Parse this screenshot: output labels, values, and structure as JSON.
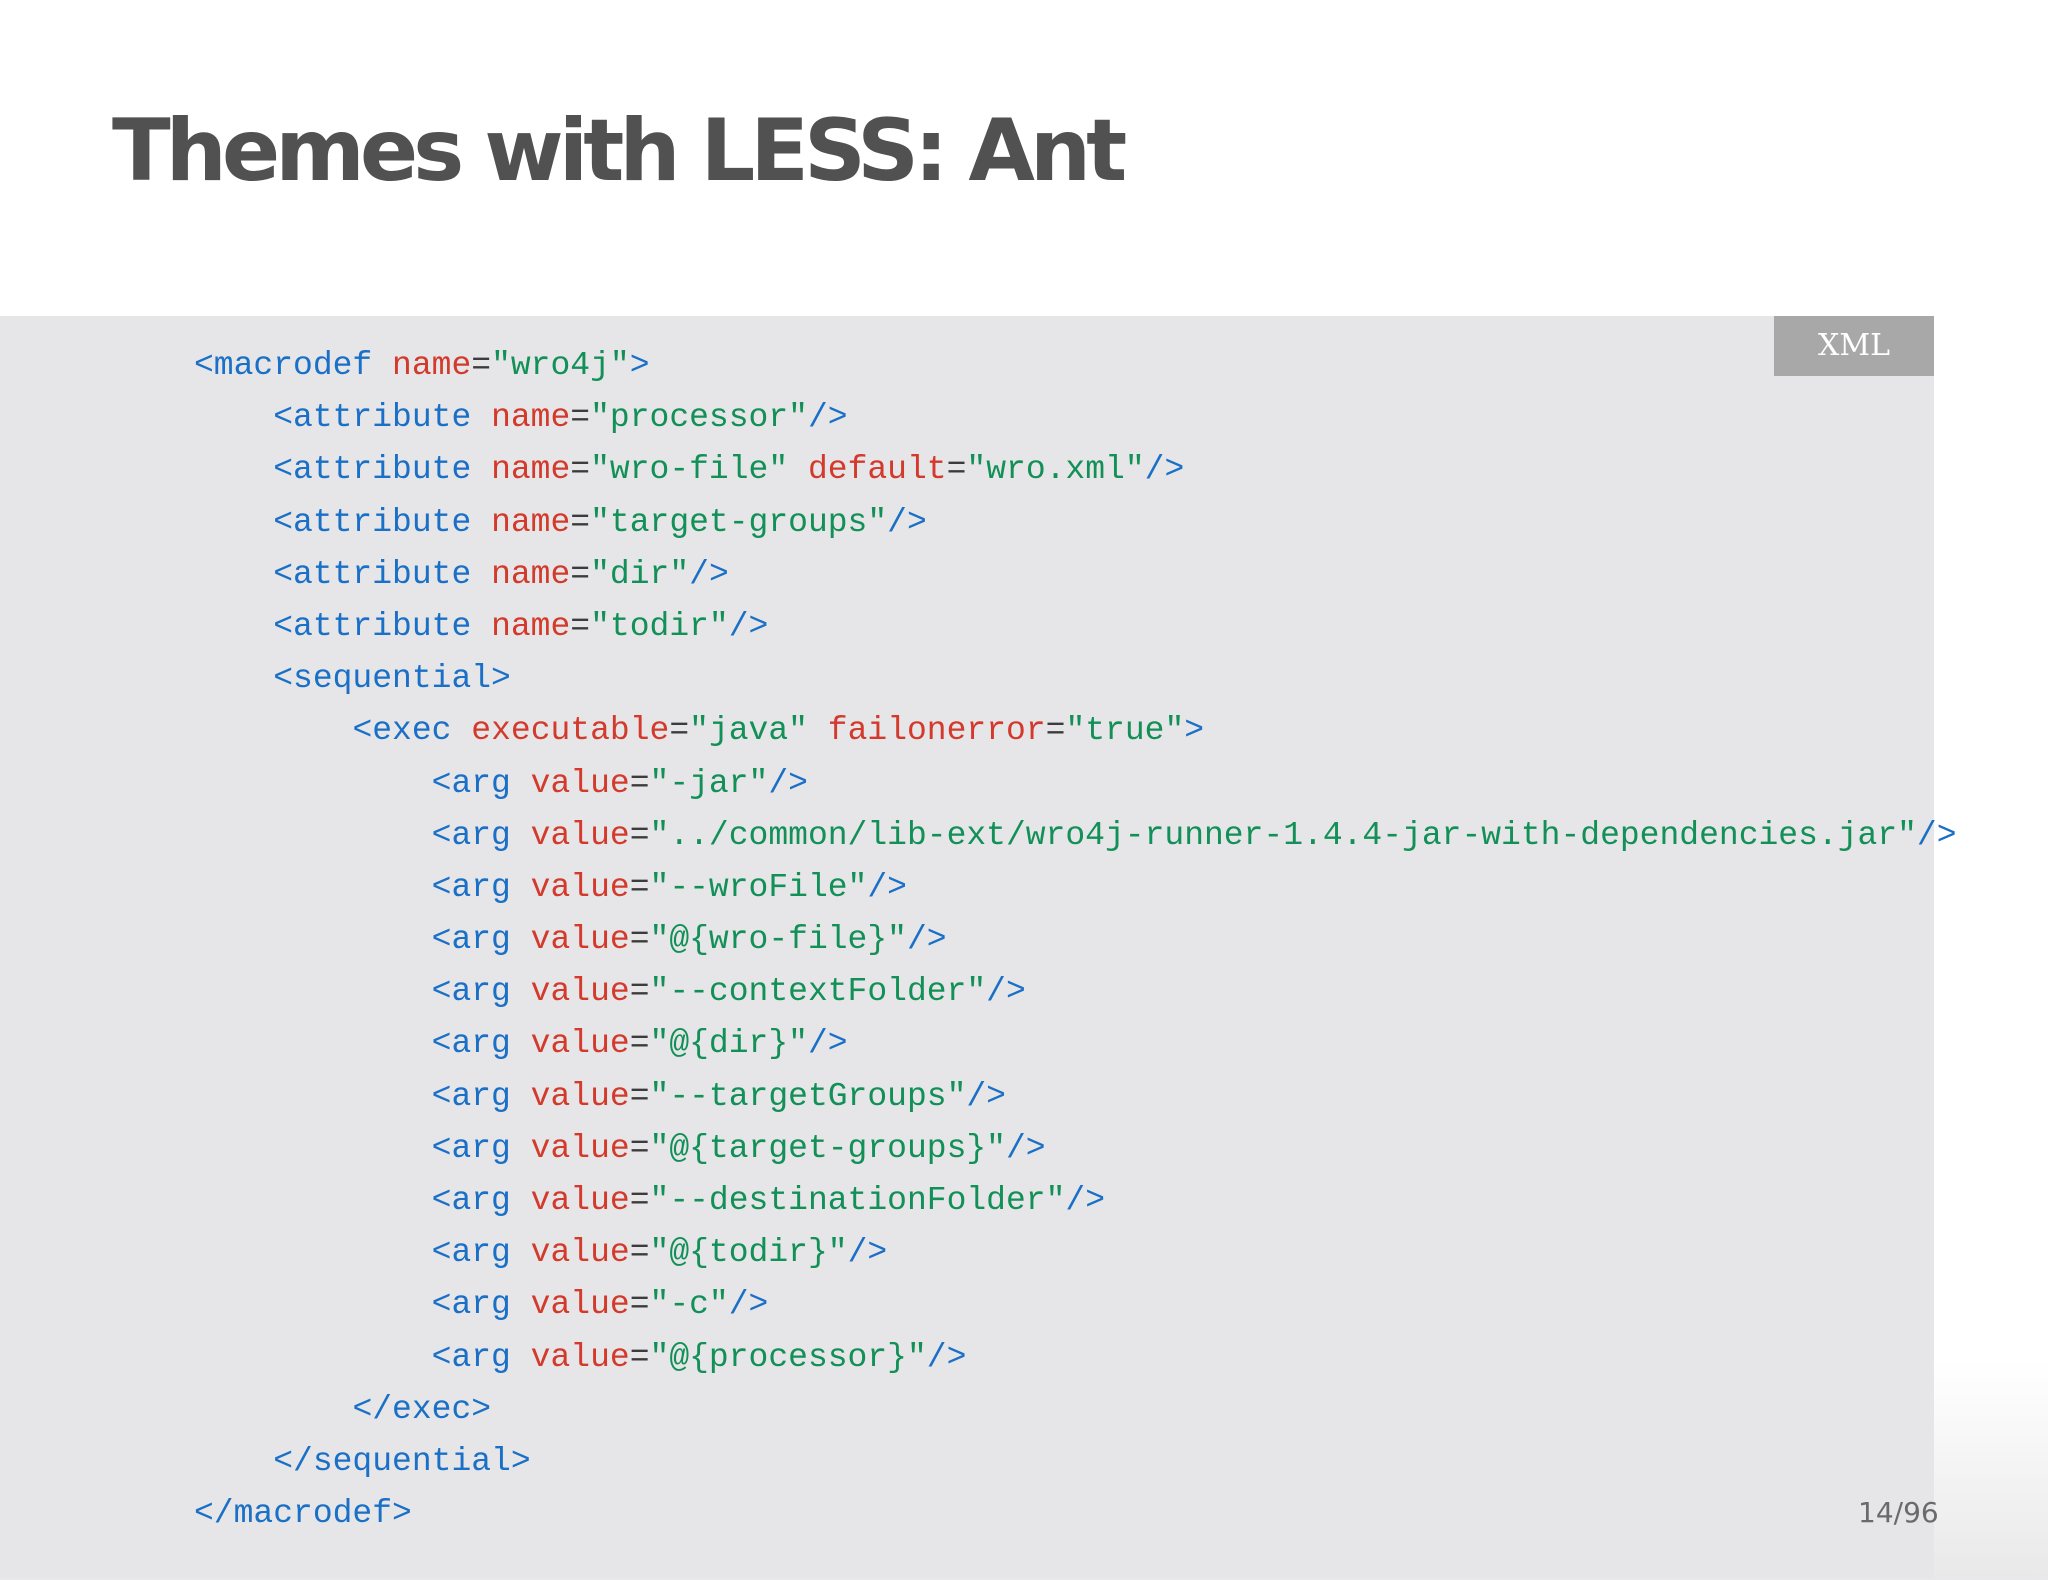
{
  "slide": {
    "title": "Themes with LESS: Ant",
    "code_language": "XML",
    "page_number": "14/96"
  },
  "code": {
    "lines": [
      {
        "indent": 0,
        "tokens": [
          {
            "t": "tag",
            "v": "<macrodef"
          },
          {
            "t": "plain",
            "v": " "
          },
          {
            "t": "attr",
            "v": "name"
          },
          {
            "t": "eq",
            "v": "="
          },
          {
            "t": "val",
            "v": "\"wro4j\""
          },
          {
            "t": "tag",
            "v": ">"
          }
        ]
      },
      {
        "indent": 1,
        "tokens": [
          {
            "t": "tag",
            "v": "<attribute"
          },
          {
            "t": "plain",
            "v": " "
          },
          {
            "t": "attr",
            "v": "name"
          },
          {
            "t": "eq",
            "v": "="
          },
          {
            "t": "val",
            "v": "\"processor\""
          },
          {
            "t": "tag",
            "v": "/>"
          }
        ]
      },
      {
        "indent": 1,
        "tokens": [
          {
            "t": "tag",
            "v": "<attribute"
          },
          {
            "t": "plain",
            "v": " "
          },
          {
            "t": "attr",
            "v": "name"
          },
          {
            "t": "eq",
            "v": "="
          },
          {
            "t": "val",
            "v": "\"wro-file\""
          },
          {
            "t": "plain",
            "v": " "
          },
          {
            "t": "attr",
            "v": "default"
          },
          {
            "t": "eq",
            "v": "="
          },
          {
            "t": "val",
            "v": "\"wro.xml\""
          },
          {
            "t": "tag",
            "v": "/>"
          }
        ]
      },
      {
        "indent": 1,
        "tokens": [
          {
            "t": "tag",
            "v": "<attribute"
          },
          {
            "t": "plain",
            "v": " "
          },
          {
            "t": "attr",
            "v": "name"
          },
          {
            "t": "eq",
            "v": "="
          },
          {
            "t": "val",
            "v": "\"target-groups\""
          },
          {
            "t": "tag",
            "v": "/>"
          }
        ]
      },
      {
        "indent": 1,
        "tokens": [
          {
            "t": "tag",
            "v": "<attribute"
          },
          {
            "t": "plain",
            "v": " "
          },
          {
            "t": "attr",
            "v": "name"
          },
          {
            "t": "eq",
            "v": "="
          },
          {
            "t": "val",
            "v": "\"dir\""
          },
          {
            "t": "tag",
            "v": "/>"
          }
        ]
      },
      {
        "indent": 1,
        "tokens": [
          {
            "t": "tag",
            "v": "<attribute"
          },
          {
            "t": "plain",
            "v": " "
          },
          {
            "t": "attr",
            "v": "name"
          },
          {
            "t": "eq",
            "v": "="
          },
          {
            "t": "val",
            "v": "\"todir\""
          },
          {
            "t": "tag",
            "v": "/>"
          }
        ]
      },
      {
        "indent": 1,
        "tokens": [
          {
            "t": "tag",
            "v": "<sequential>"
          }
        ]
      },
      {
        "indent": 2,
        "tokens": [
          {
            "t": "tag",
            "v": "<exec"
          },
          {
            "t": "plain",
            "v": " "
          },
          {
            "t": "attr",
            "v": "executable"
          },
          {
            "t": "eq",
            "v": "="
          },
          {
            "t": "val",
            "v": "\"java\""
          },
          {
            "t": "plain",
            "v": " "
          },
          {
            "t": "attr",
            "v": "failonerror"
          },
          {
            "t": "eq",
            "v": "="
          },
          {
            "t": "val",
            "v": "\"true\""
          },
          {
            "t": "tag",
            "v": ">"
          }
        ]
      },
      {
        "indent": 3,
        "tokens": [
          {
            "t": "tag",
            "v": "<arg"
          },
          {
            "t": "plain",
            "v": " "
          },
          {
            "t": "attr",
            "v": "value"
          },
          {
            "t": "eq",
            "v": "="
          },
          {
            "t": "val",
            "v": "\"-jar\""
          },
          {
            "t": "tag",
            "v": "/>"
          }
        ]
      },
      {
        "indent": 3,
        "tokens": [
          {
            "t": "tag",
            "v": "<arg"
          },
          {
            "t": "plain",
            "v": " "
          },
          {
            "t": "attr",
            "v": "value"
          },
          {
            "t": "eq",
            "v": "="
          },
          {
            "t": "val",
            "v": "\"../common/lib-ext/wro4j-runner-1.4.4-jar-with-dependencies.jar\""
          },
          {
            "t": "tag",
            "v": "/>"
          }
        ]
      },
      {
        "indent": 3,
        "tokens": [
          {
            "t": "tag",
            "v": "<arg"
          },
          {
            "t": "plain",
            "v": " "
          },
          {
            "t": "attr",
            "v": "value"
          },
          {
            "t": "eq",
            "v": "="
          },
          {
            "t": "val",
            "v": "\"--wroFile\""
          },
          {
            "t": "tag",
            "v": "/>"
          }
        ]
      },
      {
        "indent": 3,
        "tokens": [
          {
            "t": "tag",
            "v": "<arg"
          },
          {
            "t": "plain",
            "v": " "
          },
          {
            "t": "attr",
            "v": "value"
          },
          {
            "t": "eq",
            "v": "="
          },
          {
            "t": "val",
            "v": "\"@{wro-file}\""
          },
          {
            "t": "tag",
            "v": "/>"
          }
        ]
      },
      {
        "indent": 3,
        "tokens": [
          {
            "t": "tag",
            "v": "<arg"
          },
          {
            "t": "plain",
            "v": " "
          },
          {
            "t": "attr",
            "v": "value"
          },
          {
            "t": "eq",
            "v": "="
          },
          {
            "t": "val",
            "v": "\"--contextFolder\""
          },
          {
            "t": "tag",
            "v": "/>"
          }
        ]
      },
      {
        "indent": 3,
        "tokens": [
          {
            "t": "tag",
            "v": "<arg"
          },
          {
            "t": "plain",
            "v": " "
          },
          {
            "t": "attr",
            "v": "value"
          },
          {
            "t": "eq",
            "v": "="
          },
          {
            "t": "val",
            "v": "\"@{dir}\""
          },
          {
            "t": "tag",
            "v": "/>"
          }
        ]
      },
      {
        "indent": 3,
        "tokens": [
          {
            "t": "tag",
            "v": "<arg"
          },
          {
            "t": "plain",
            "v": " "
          },
          {
            "t": "attr",
            "v": "value"
          },
          {
            "t": "eq",
            "v": "="
          },
          {
            "t": "val",
            "v": "\"--targetGroups\""
          },
          {
            "t": "tag",
            "v": "/>"
          }
        ]
      },
      {
        "indent": 3,
        "tokens": [
          {
            "t": "tag",
            "v": "<arg"
          },
          {
            "t": "plain",
            "v": " "
          },
          {
            "t": "attr",
            "v": "value"
          },
          {
            "t": "eq",
            "v": "="
          },
          {
            "t": "val",
            "v": "\"@{target-groups}\""
          },
          {
            "t": "tag",
            "v": "/>"
          }
        ]
      },
      {
        "indent": 3,
        "tokens": [
          {
            "t": "tag",
            "v": "<arg"
          },
          {
            "t": "plain",
            "v": " "
          },
          {
            "t": "attr",
            "v": "value"
          },
          {
            "t": "eq",
            "v": "="
          },
          {
            "t": "val",
            "v": "\"--destinationFolder\""
          },
          {
            "t": "tag",
            "v": "/>"
          }
        ]
      },
      {
        "indent": 3,
        "tokens": [
          {
            "t": "tag",
            "v": "<arg"
          },
          {
            "t": "plain",
            "v": " "
          },
          {
            "t": "attr",
            "v": "value"
          },
          {
            "t": "eq",
            "v": "="
          },
          {
            "t": "val",
            "v": "\"@{todir}\""
          },
          {
            "t": "tag",
            "v": "/>"
          }
        ]
      },
      {
        "indent": 3,
        "tokens": [
          {
            "t": "tag",
            "v": "<arg"
          },
          {
            "t": "plain",
            "v": " "
          },
          {
            "t": "attr",
            "v": "value"
          },
          {
            "t": "eq",
            "v": "="
          },
          {
            "t": "val",
            "v": "\"-c\""
          },
          {
            "t": "tag",
            "v": "/>"
          }
        ]
      },
      {
        "indent": 3,
        "tokens": [
          {
            "t": "tag",
            "v": "<arg"
          },
          {
            "t": "plain",
            "v": " "
          },
          {
            "t": "attr",
            "v": "value"
          },
          {
            "t": "eq",
            "v": "="
          },
          {
            "t": "val",
            "v": "\"@{processor}\""
          },
          {
            "t": "tag",
            "v": "/>"
          }
        ]
      },
      {
        "indent": 2,
        "tokens": [
          {
            "t": "tag",
            "v": "</exec>"
          }
        ]
      },
      {
        "indent": 1,
        "tokens": [
          {
            "t": "tag",
            "v": "</sequential>"
          }
        ]
      },
      {
        "indent": 0,
        "tokens": [
          {
            "t": "tag",
            "v": "</macrodef>"
          }
        ]
      }
    ]
  },
  "colors": {
    "tag": "#1a6fc6",
    "attribute": "#d33a2c",
    "value": "#129057",
    "title": "#515151",
    "code_background": "#e6e6e8",
    "badge_background": "#a8a8a8"
  }
}
